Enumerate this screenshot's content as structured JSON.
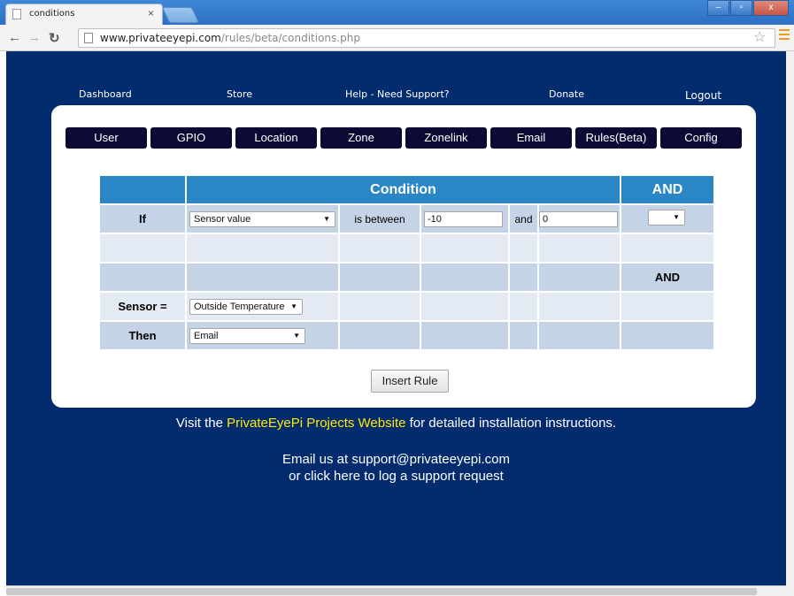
{
  "browser": {
    "tab_title": "conditions",
    "tab_close": "×",
    "url_host": "www.privateeyepi.com",
    "url_path": "/rules/beta/conditions.php",
    "window_controls": [
      "–",
      "▫",
      "x"
    ]
  },
  "topnav": [
    "Dashboard",
    "Store",
    "Help - Need Support?",
    "Donate",
    "Logout"
  ],
  "tabs": [
    "User",
    "GPIO",
    "Location",
    "Zone",
    "Zonelink",
    "Email",
    "Rules(Beta)",
    "Config"
  ],
  "table": {
    "header_condition": "Condition",
    "header_and": "AND",
    "if_label": "If",
    "if_select": "Sensor value",
    "is_between": "is between",
    "val1": "-10",
    "and_text": "and",
    "val2": "0",
    "and_select": "",
    "and_row_label": "AND",
    "sensor_label": "Sensor =",
    "sensor_select": "Outside Temperature",
    "then_label": "Then",
    "then_select": "Email"
  },
  "insert_button": "Insert Rule",
  "footer": {
    "visit_prefix": "Visit the ",
    "visit_link": "PrivateEyePi Projects Website",
    "visit_suffix": " for detailed installation instructions.",
    "email_line": "Email us at support@privateeyepi.com",
    "support_line": "or click here to log a support request"
  },
  "colors": {
    "page_bg": "#032c6e",
    "header_bg": "#2b86c6",
    "tab_bg": "#0a0a35",
    "link_yellow": "#ffea00"
  }
}
